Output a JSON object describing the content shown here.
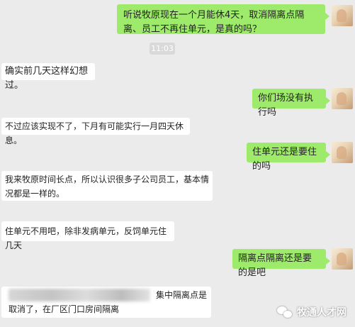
{
  "messages": [
    {
      "side": "right",
      "text": "听说牧原现在一个月能休4天，取消隔离点隔离、员工不再住单元，是真的吗？"
    },
    {
      "side": "left",
      "text": "确实前几天这样幻想过。"
    },
    {
      "side": "right",
      "text": "你们场没有执行吗"
    },
    {
      "side": "left",
      "text": "不过应该实现不了，下月有可能实行一月四天休息。"
    },
    {
      "side": "right",
      "text": "住单元还是要住的吗"
    },
    {
      "side": "left",
      "text": "我来牧原时间长点，所以认识很多子公司员工，基本情况都是一样的。"
    },
    {
      "side": "left",
      "text": "住单元不用吧，除非发病单元，反饲单元住几天"
    },
    {
      "side": "right",
      "text": "隔离点隔离还是要的是吧"
    },
    {
      "side": "left",
      "text": "集中隔离点是取消了，在厂区门口房间隔离"
    }
  ],
  "timestamp": "11:03",
  "watermark": {
    "text": "牧通人才网",
    "icon": "wechat-icon"
  },
  "colors": {
    "background": "#ebebeb",
    "sent_bubble": "#9eea6a",
    "received_bubble": "#ffffff"
  }
}
